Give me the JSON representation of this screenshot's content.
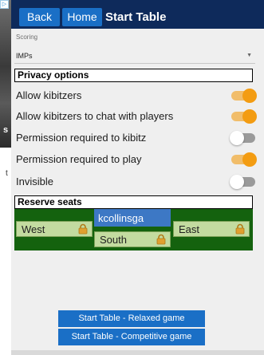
{
  "background": {
    "ad_marker": "▷",
    "fragment_s": "s",
    "fragment_t": "t"
  },
  "topbar": {
    "back_label": "Back",
    "home_label": "Home",
    "title": "Start Table"
  },
  "scoring": {
    "label": "Scoring",
    "value": "IMPs"
  },
  "privacy": {
    "header": "Privacy options",
    "options": [
      {
        "label": "Allow kibitzers",
        "enabled": true
      },
      {
        "label": "Allow kibitzers to chat with players",
        "enabled": true
      },
      {
        "label": "Permission required to kibitz",
        "enabled": false
      },
      {
        "label": "Permission required to play",
        "enabled": true
      },
      {
        "label": "Invisible",
        "enabled": false
      }
    ]
  },
  "reserve": {
    "header": "Reserve seats",
    "north_player": "kcollinsga",
    "seats": {
      "west": "West",
      "south": "South",
      "east": "East"
    }
  },
  "actions": {
    "relaxed": "Start Table - Relaxed game",
    "competitive": "Start Table - Competitive game"
  },
  "colors": {
    "topbar": "#0e2a5b",
    "button": "#1a6fc6",
    "toggle_on": "#f39c12",
    "table_green": "#14620e",
    "seat_fill": "#c3dba0",
    "north_fill": "#3d78c5",
    "lock": "#e0a030"
  }
}
